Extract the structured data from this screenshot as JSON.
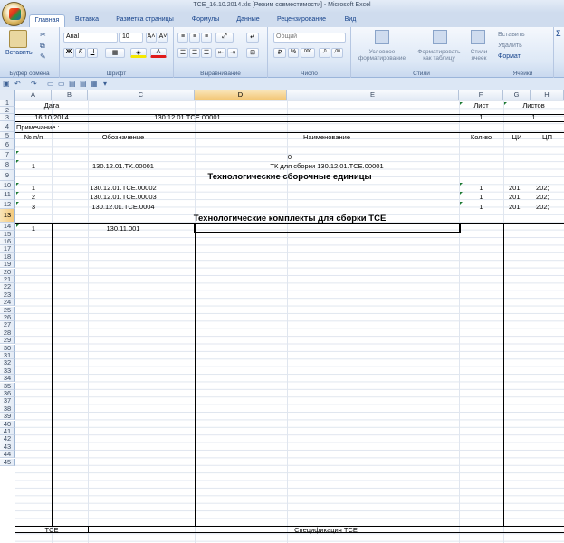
{
  "window": {
    "title": "TCE_16.10.2014.xls  [Режим совместимости] - Microsoft Excel"
  },
  "tabs": [
    "Главная",
    "Вставка",
    "Разметка страницы",
    "Формулы",
    "Данные",
    "Рецензирование",
    "Вид"
  ],
  "ribbon": {
    "clipboard": {
      "paste_label": "Вставить",
      "group_label": "Буфер обмена"
    },
    "font": {
      "name": "Arial",
      "size": "10",
      "bold": "Ж",
      "italic": "К",
      "underline": "Ч",
      "group_label": "Шрифт"
    },
    "alignment": {
      "group_label": "Выравнивание"
    },
    "number": {
      "format": "Общий",
      "group_label": "Число"
    },
    "styles": {
      "cond_format": "Условное форматирование",
      "table_format": "Форматировать как таблицу",
      "cell_styles": "Стили ячеек",
      "group_label": "Стили"
    },
    "cells": {
      "insert": "Вставить",
      "delete": "Удалить",
      "format": "Формат",
      "group_label": "Ячейки"
    },
    "sigma": "Σ"
  },
  "columns": [
    "A",
    "B",
    "C",
    "D",
    "E",
    "F",
    "G",
    "H"
  ],
  "rows": [
    "1",
    "2",
    "3",
    "4",
    "5",
    "6",
    "7",
    "8",
    "9",
    "10",
    "11",
    "12",
    "13",
    "14",
    "15",
    "16",
    "17",
    "18",
    "19",
    "20",
    "21",
    "22",
    "23",
    "24",
    "25",
    "26",
    "27",
    "28",
    "29",
    "30",
    "31",
    "32",
    "33",
    "34",
    "35",
    "36",
    "37",
    "38",
    "39",
    "40",
    "41",
    "42",
    "43",
    "44",
    "45"
  ],
  "sheet": {
    "r1": {
      "date": "Дата",
      "sheet": "Лист",
      "sheets": "Листов"
    },
    "r2": {
      "date": "16.10.2014",
      "code": "130.12.01.TCE.00001",
      "sheet": "1",
      "sheets": "1"
    },
    "r3": {
      "note": "Примечание :"
    },
    "r4": {
      "num": "№ п/п",
      "designation": "Обозначение",
      "name": "Наименование",
      "qty": "Кол-во",
      "ci": "ЦИ",
      "cp": "ЦП"
    },
    "r6": {
      "zero": "0"
    },
    "r7": {
      "num": "1",
      "designation": "130.12.01.TK.00001",
      "name": "ТК для сборки 130.12.01.TCE.00001"
    },
    "r8": {
      "header": "Технологические сборочные единицы"
    },
    "r9": {
      "num": "1",
      "designation": "130.12.01.TCE.00002",
      "qty": "1",
      "ci": "201;",
      "cp": "202;"
    },
    "r10": {
      "num": "2",
      "designation": "130.12.01.TCE.00003",
      "qty": "1",
      "ci": "201;",
      "cp": "202;"
    },
    "r11": {
      "num": "3",
      "designation": "130.12.01.TCE.0004",
      "qty": "1",
      "ci": "201;",
      "cp": "202;"
    },
    "r12": {
      "header": "Технологические комплекты для сборки TCE"
    },
    "r13": {
      "num": "1",
      "designation": "130.11.001"
    },
    "r44": {
      "left": "TCE",
      "right": "Спецификация TCE"
    }
  },
  "colors": {
    "accent": "#15428b",
    "ribbon": "#dde8f6",
    "selection": "#f3c777",
    "grid": "#e0e6ef"
  }
}
